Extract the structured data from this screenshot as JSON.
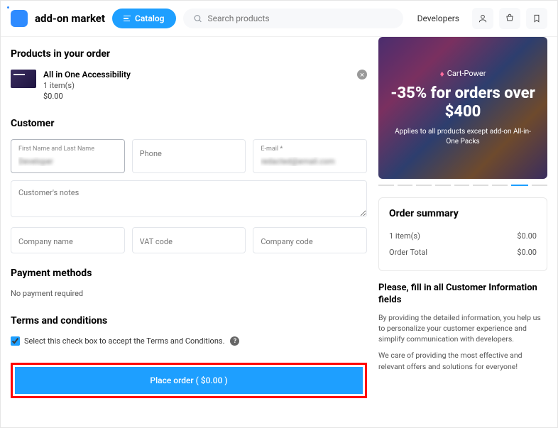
{
  "header": {
    "brand": "add-on market",
    "catalog_label": "Catalog",
    "search_placeholder": "Search products",
    "developers_link": "Developers"
  },
  "products_section": {
    "title": "Products in your order",
    "items": [
      {
        "name": "All in One Accessibility",
        "qty": "1 item(s)",
        "price": "$0.00"
      }
    ]
  },
  "customer_section": {
    "title": "Customer",
    "first_name_label": "First Name and Last Name",
    "first_name_value": "Developer",
    "phone_placeholder": "Phone",
    "email_label": "E-mail *",
    "email_value": "redacted@email.com",
    "notes_placeholder": "Customer's notes",
    "company_placeholder": "Company name",
    "vat_placeholder": "VAT code",
    "company_code_placeholder": "Company code"
  },
  "payment_section": {
    "title": "Payment methods",
    "text": "No payment required"
  },
  "terms_section": {
    "title": "Terms and conditions",
    "checkbox_label": "Select this check box to accept the Terms and Conditions."
  },
  "place_order_label": "Place order ( $0.00 )",
  "promo": {
    "brand": "Cart-Power",
    "headline": "-35% for orders over $400",
    "subtext": "Applies to all products except add-on All-in-One Packs"
  },
  "summary": {
    "title": "Order summary",
    "rows": [
      {
        "label": "1 item(s)",
        "value": "$0.00"
      },
      {
        "label": "Order Total",
        "value": "$0.00"
      }
    ]
  },
  "info": {
    "title": "Please, fill in all Customer Information fields",
    "p1": "By providing the detailed information, you help us to personalize your customer experience and simplify communication with developers.",
    "p2": "We care of providing the most effective and relevant offers and solutions for everyone!"
  }
}
